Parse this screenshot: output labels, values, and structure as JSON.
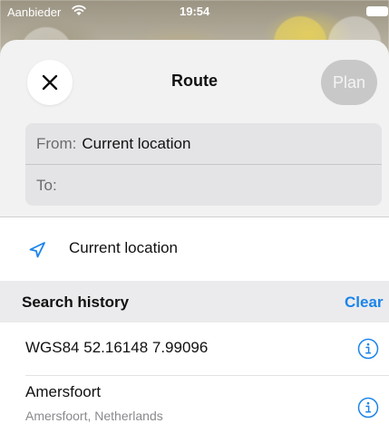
{
  "status_bar": {
    "carrier": "Aanbieder",
    "time": "19:54"
  },
  "header": {
    "title": "Route",
    "plan_label": "Plan",
    "close_icon": "close-icon"
  },
  "route": {
    "from_label": "From:",
    "from_value": "Current location",
    "to_label": "To:",
    "to_value": ""
  },
  "current_location": {
    "label": "Current location",
    "icon": "location-arrow-icon"
  },
  "history": {
    "title": "Search history",
    "clear_label": "Clear",
    "items": [
      {
        "name": "WGS84 52.16148 7.99096",
        "subtitle": ""
      },
      {
        "name": "Amersfoort",
        "subtitle": "Amersfoort, Netherlands"
      }
    ]
  },
  "colors": {
    "accent": "#1a84ea",
    "plan_disabled": "#c8c8c8"
  }
}
